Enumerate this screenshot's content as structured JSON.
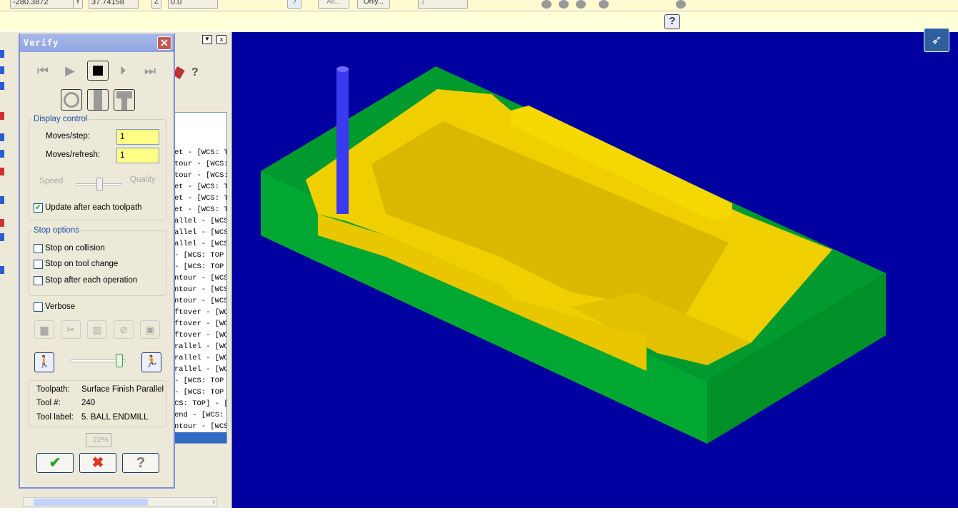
{
  "toolbar": {
    "x_value": "-280.3872",
    "y_label": "Y",
    "y_value": "37.74158",
    "z_label": "Z",
    "z_value": "0.0",
    "all_button": "All...",
    "only_button": "Only...",
    "level_value": "1",
    "help_icon": "?"
  },
  "oplist": {
    "rows": [
      "et - [WCS: T",
      "tour - [WCS:",
      "tour - [WCS:",
      "et - [WCS: T",
      "et - [WCS: T",
      "et - [WCS: T",
      "allel - [WCS",
      "allel - [WCS",
      "allel - [WCS",
      " - [WCS: TOP",
      " - [WCS: TOP",
      "ntour - [WCS",
      "ntour - [WCS",
      "ntour - [WCS",
      "ftover - [WC",
      "ftover - [WC",
      "ftover - [WC",
      "rallel - [WC",
      "rallel - [WC",
      "rallel - [WC",
      " - [WCS: TOP",
      " - [WCS: TOP",
      "CS: TOP] - [",
      "end - [WCS:",
      "ntour - [WCS",
      ""
    ],
    "selected_index": 25
  },
  "dialog": {
    "title": "Verify",
    "display_control": {
      "legend": "Display control",
      "moves_step_label": "Moves/step:",
      "moves_step_value": "1",
      "moves_refresh_label": "Moves/refresh:",
      "moves_refresh_value": "1",
      "speed_label": "Speed",
      "quality_label": "Quality",
      "speed_quality_level": 0.5,
      "update_label": "Update after each toolpath",
      "update_checked": true
    },
    "stop_options": {
      "legend": "Stop options",
      "collision": "Stop on collision",
      "tool_change": "Stop on tool change",
      "each_operation": "Stop after each operation"
    },
    "verbose": "Verbose",
    "sim_speed": 1.0,
    "info": {
      "toolpath_label": "Toolpath:",
      "toolpath_value": "Surface Finish Parallel",
      "tool_num_label": "Tool #:",
      "tool_num_value": "240",
      "tool_label_label": "Tool label:",
      "tool_label_value": "5. BALL ENDMILL"
    },
    "progress": "22%"
  },
  "colors": {
    "viewport": "#0000a0",
    "stock": "#009a2e",
    "part": "#f2d200",
    "tool": "#3a3af0"
  }
}
